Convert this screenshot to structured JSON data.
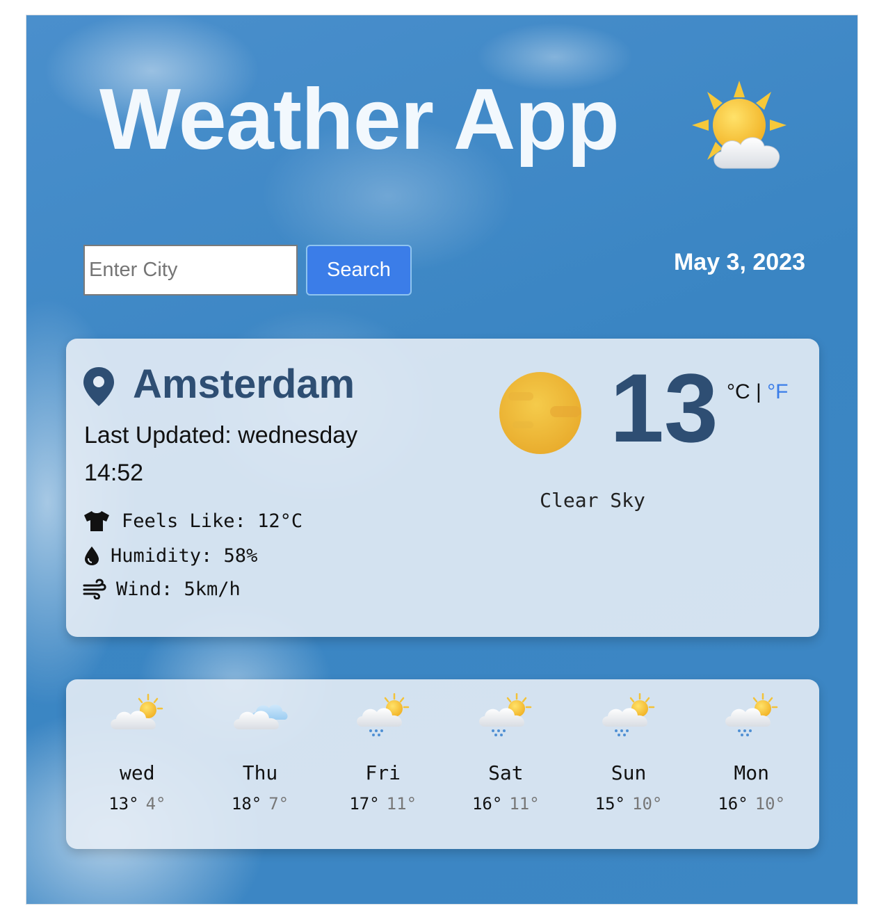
{
  "header": {
    "title": "Weather App",
    "title_icon": "sun-behind-cloud-icon"
  },
  "search": {
    "placeholder": "Enter City",
    "value": "",
    "button_label": "Search"
  },
  "date": "May 3, 2023",
  "current": {
    "city": "Amsterdam",
    "last_updated": "Last Updated: wednesday 14:52",
    "feels_like": "Feels Like: 12°C",
    "humidity": "Humidity: 58%",
    "wind": "Wind: 5km/h",
    "temperature": "13",
    "unit_celsius": "°C",
    "unit_separator": "|",
    "unit_fahrenheit": "°F",
    "condition": "Clear Sky",
    "condition_icon": "clear-sky-sun-icon"
  },
  "forecast": [
    {
      "day": "wed",
      "high": "13°",
      "low": "4°",
      "icon": "partly-cloudy-icon"
    },
    {
      "day": "Thu",
      "high": "18°",
      "low": "7°",
      "icon": "cloudy-icon"
    },
    {
      "day": "Fri",
      "high": "17°",
      "low": "11°",
      "icon": "sun-rain-icon"
    },
    {
      "day": "Sat",
      "high": "16°",
      "low": "11°",
      "icon": "sun-rain-icon"
    },
    {
      "day": "Sun",
      "high": "15°",
      "low": "10°",
      "icon": "sun-rain-icon"
    },
    {
      "day": "Mon",
      "high": "16°",
      "low": "10°",
      "icon": "sun-rain-icon"
    }
  ],
  "colors": {
    "accent": "#3b7de8",
    "city_text": "#2e4e73",
    "sky": "#3d87c4"
  }
}
